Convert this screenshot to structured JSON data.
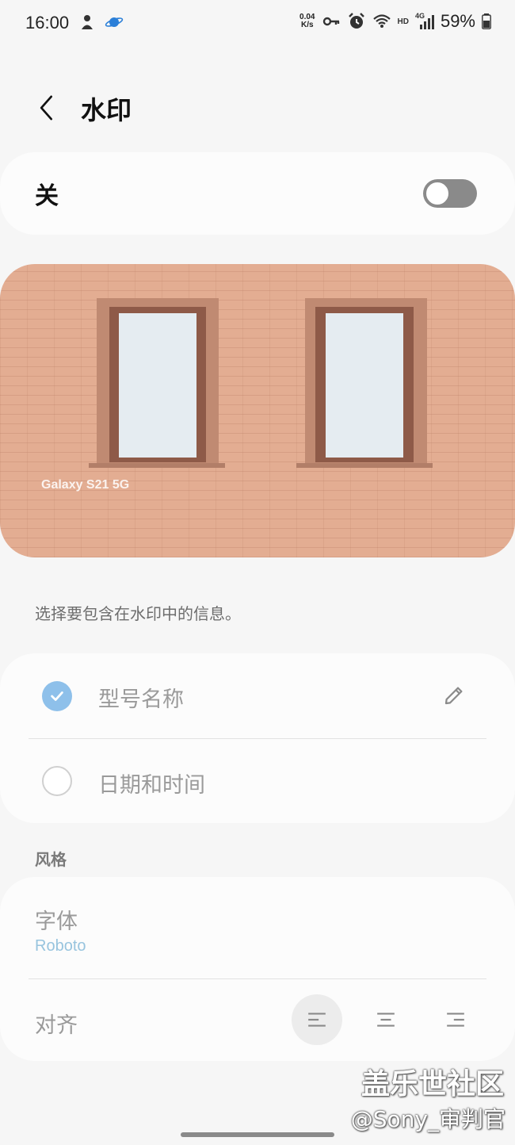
{
  "status_bar": {
    "time": "16:00",
    "net_speed_value": "0.04",
    "net_speed_unit": "K/s",
    "network_label": "HD",
    "signal_label": "4G",
    "battery": "59%"
  },
  "header": {
    "title": "水印"
  },
  "toggle": {
    "label": "关",
    "state": "off"
  },
  "preview": {
    "watermark_text": "Galaxy S21 5G"
  },
  "hint": "选择要包含在水印中的信息。",
  "options": {
    "items": [
      {
        "label": "型号名称",
        "checked": true
      },
      {
        "label": "日期和时间",
        "checked": false
      }
    ]
  },
  "style": {
    "section_title": "风格",
    "font_label": "字体",
    "font_value": "Roboto",
    "align_label": "对齐",
    "align_selected": "left"
  },
  "overlay": {
    "site": "盖乐世社区",
    "author": "@Sony_审判官"
  },
  "colors": {
    "accent": "#8ec0ea",
    "font_value": "#98c4de",
    "switch_off": "#8a8a8a"
  }
}
